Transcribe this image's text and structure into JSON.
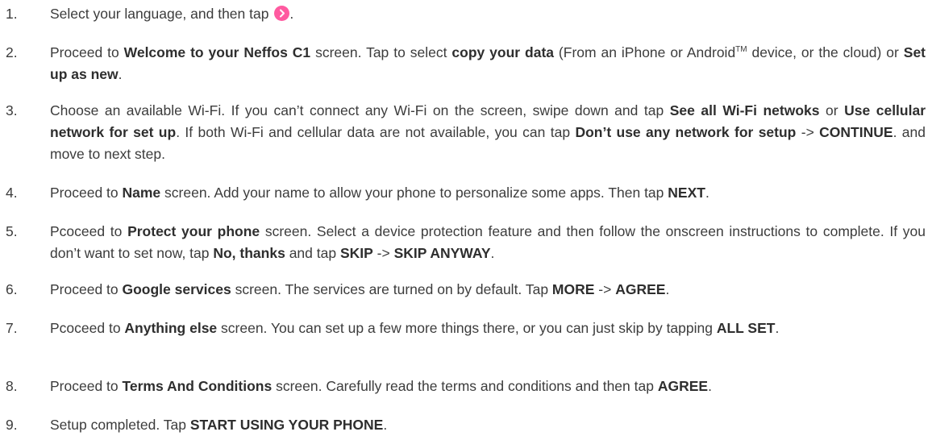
{
  "steps": [
    {
      "number": "1.",
      "parts": [
        {
          "text": "Select your language, and then tap "
        },
        {
          "icon": "next-arrow-icon"
        },
        {
          "text": "."
        }
      ]
    },
    {
      "number": "2.",
      "parts": [
        {
          "text": "Proceed to "
        },
        {
          "text": "Welcome to your Neffos C1",
          "bold": true
        },
        {
          "text": " screen. Tap to select "
        },
        {
          "text": "copy your data",
          "bold": true
        },
        {
          "text": " (From an iPhone or Android"
        },
        {
          "text": "TM",
          "sup": true
        },
        {
          "text": " device, or the cloud) or "
        },
        {
          "text": "Set up as new",
          "bold": true
        },
        {
          "text": "."
        }
      ]
    },
    {
      "number": "3.",
      "parts": [
        {
          "text": "Choose an available Wi-Fi. If you can’t connect any Wi-Fi on the screen, swipe down and tap "
        },
        {
          "text": "See all Wi-Fi netwoks",
          "bold": true
        },
        {
          "text": " or "
        },
        {
          "text": "Use cellular network for set up",
          "bold": true
        },
        {
          "text": ". If both Wi-Fi and cellular data are not available, you can tap "
        },
        {
          "text": "Don’t use any network for setup",
          "bold": true
        },
        {
          "text": " -> "
        },
        {
          "text": "CONTINUE",
          "bold": true
        },
        {
          "text": ". and move to next step."
        }
      ]
    },
    {
      "number": "4.",
      "parts": [
        {
          "text": "Proceed to "
        },
        {
          "text": "Name",
          "bold": true
        },
        {
          "text": " screen. Add your name to allow your phone to personalize some apps. Then tap "
        },
        {
          "text": "NEXT",
          "bold": true
        },
        {
          "text": "."
        }
      ]
    },
    {
      "number": "5.",
      "parts": [
        {
          "text": "Pcoceed to "
        },
        {
          "text": "Protect your phone",
          "bold": true
        },
        {
          "text": " screen. Select a device protection feature and then follow the onscreen instructions to complete. If you don’t want to set now, tap "
        },
        {
          "text": "No, thanks",
          "bold": true
        },
        {
          "text": " and tap "
        },
        {
          "text": "SKIP",
          "bold": true
        },
        {
          "text": " -> "
        },
        {
          "text": "SKIP ANYWAY",
          "bold": true
        },
        {
          "text": "."
        }
      ]
    },
    {
      "number": "6.",
      "parts": [
        {
          "text": "Proceed to "
        },
        {
          "text": "Google services",
          "bold": true
        },
        {
          "text": " screen. The services are turned on by default. Tap "
        },
        {
          "text": "MORE",
          "bold": true
        },
        {
          "text": " -> "
        },
        {
          "text": "AGREE",
          "bold": true
        },
        {
          "text": "."
        }
      ]
    },
    {
      "number": "7.",
      "parts": [
        {
          "text": "Pcoceed to "
        },
        {
          "text": "Anything else",
          "bold": true
        },
        {
          "text": " screen. You can set up a few more things there, or you can just skip by tapping "
        },
        {
          "text": "ALL SET",
          "bold": true
        },
        {
          "text": "."
        }
      ]
    },
    {
      "number": "8.",
      "parts": [
        {
          "text": "Proceed to "
        },
        {
          "text": "Terms And Conditions",
          "bold": true
        },
        {
          "text": " screen. Carefully read the terms and conditions and then tap "
        },
        {
          "text": "AGREE",
          "bold": true
        },
        {
          "text": "."
        }
      ]
    },
    {
      "number": "9.",
      "parts": [
        {
          "text": "Setup completed. Tap "
        },
        {
          "text": "START USING YOUR PHONE",
          "bold": true
        },
        {
          "text": "."
        }
      ]
    }
  ],
  "colors": {
    "text": "#3c3c3c",
    "accent_pink": "#ff5aa0"
  }
}
